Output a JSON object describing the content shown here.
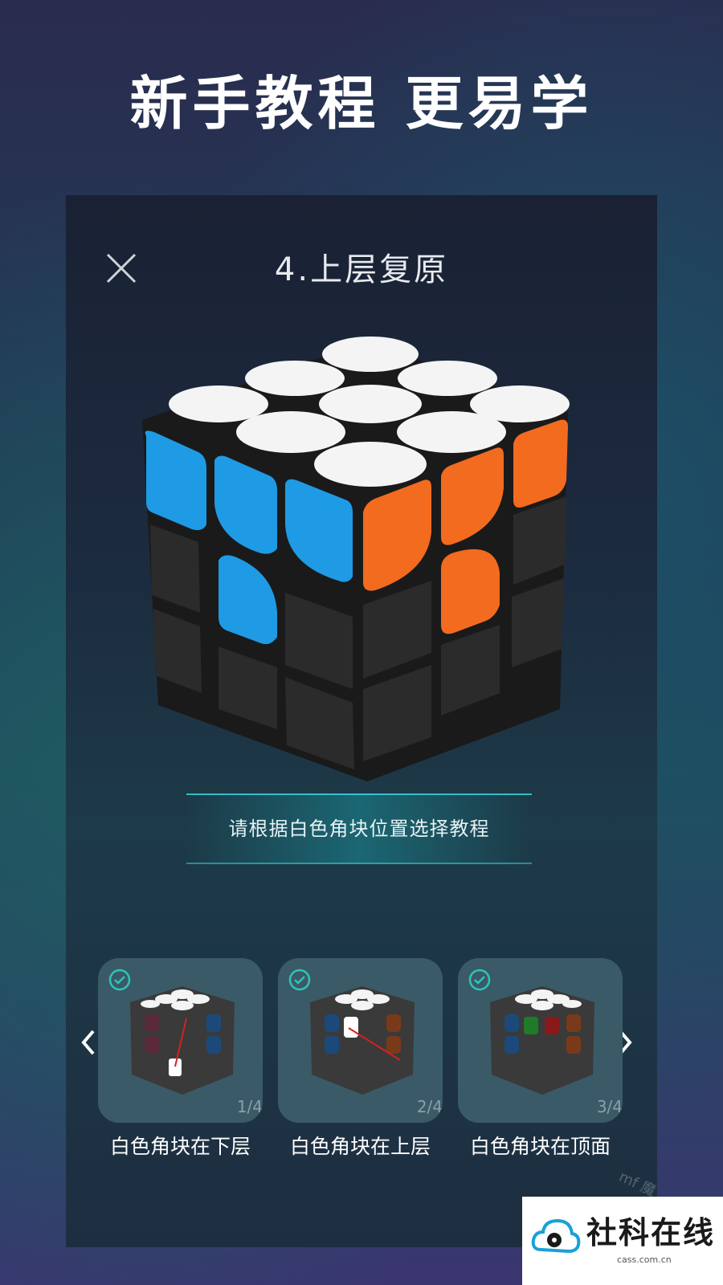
{
  "headline": "新手教程 更易学",
  "screen": {
    "title": "4.上层复原",
    "hint": "请根据白色角块位置选择教程"
  },
  "cards": [
    {
      "label": "白色角块在下层",
      "page": "1/4"
    },
    {
      "label": "白色角块在上层",
      "page": "2/4"
    },
    {
      "label": "白色角块在顶面",
      "page": "3/4"
    }
  ],
  "watermark": "mf 魔",
  "brand": {
    "name": "社科在线",
    "domain": "cass.com.cn"
  },
  "colors": {
    "accent": "#2ec4b6",
    "cube_white": "#f4f4f4",
    "cube_blue": "#1e9be4",
    "cube_orange": "#f26b1f",
    "cube_dark": "#2b2b2b"
  },
  "icons": {
    "close": "close-icon",
    "prev": "chevron-left-icon",
    "next": "chevron-right-icon",
    "check": "check-circle-icon"
  }
}
